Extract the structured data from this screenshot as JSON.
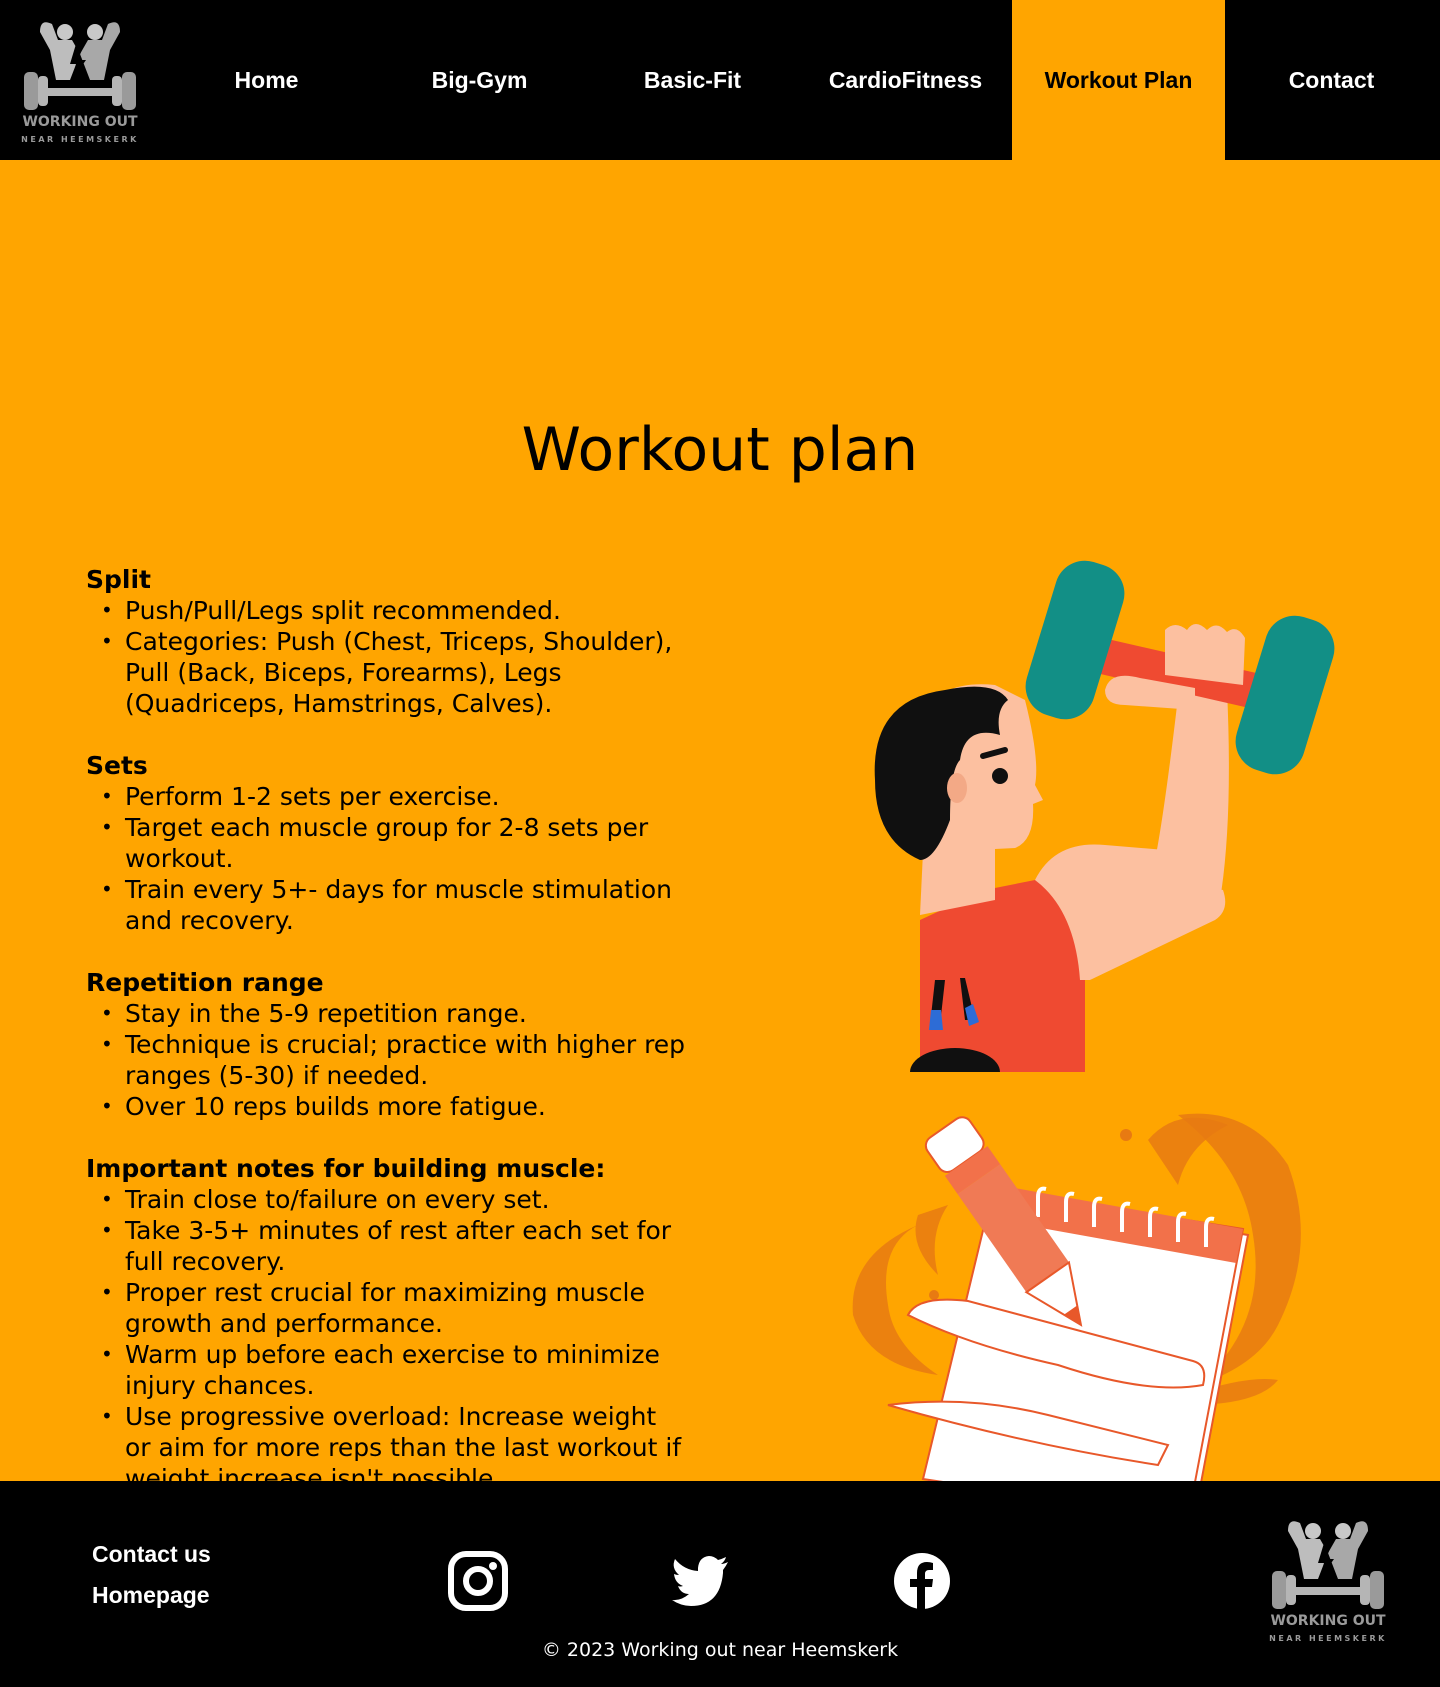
{
  "brand": {
    "logo_line1": "WORKING OUT",
    "logo_line2": "NEAR HEEMSKERK"
  },
  "nav": {
    "items": [
      {
        "label": "Home"
      },
      {
        "label": "Big-Gym"
      },
      {
        "label": "Basic-Fit"
      },
      {
        "label": "CardioFitness"
      },
      {
        "label": "Workout Plan",
        "active": true
      },
      {
        "label": "Contact"
      }
    ]
  },
  "page": {
    "title": "Workout plan"
  },
  "sections": [
    {
      "heading": "Split",
      "items": [
        "Push/Pull/Legs split recommended.",
        "Categories: Push (Chest, Triceps, Shoulder), Pull (Back, Biceps, Forearms), Legs (Quadriceps, Hamstrings, Calves)."
      ]
    },
    {
      "heading": "Sets",
      "items": [
        "Perform 1-2 sets per exercise.",
        "Target each muscle group for 2-8 sets per workout.",
        "Train every 5+- days for muscle stimulation and recovery."
      ]
    },
    {
      "heading": "Repetition range",
      "items": [
        "Stay in the 5-9 repetition range.",
        "Technique is crucial; practice with higher rep ranges (5-30) if needed.",
        "Over 10 reps builds more fatigue."
      ]
    },
    {
      "heading": "Important notes for building muscle:",
      "items": [
        "Train close to/failure on every set.",
        "Take 3-5+ minutes of rest after each set for full recovery.",
        "Proper rest crucial for maximizing muscle growth and performance.",
        "Warm up before each exercise to minimize injury chances.",
        "Use progressive overload: Increase weight or aim for more reps than the last workout if weight increase isn't possible."
      ]
    }
  ],
  "footer": {
    "links": [
      "Contact us",
      "Homepage"
    ],
    "social": [
      "instagram-icon",
      "twitter-icon",
      "facebook-icon"
    ],
    "copyright": "© 2023 Working out near Heemskerk"
  },
  "colors": {
    "accent": "#ffa500",
    "header_bg": "#000000",
    "dumbbell_weight": "#128f86",
    "shirt": "#ef4a31",
    "skin": "#fcc0a0"
  }
}
